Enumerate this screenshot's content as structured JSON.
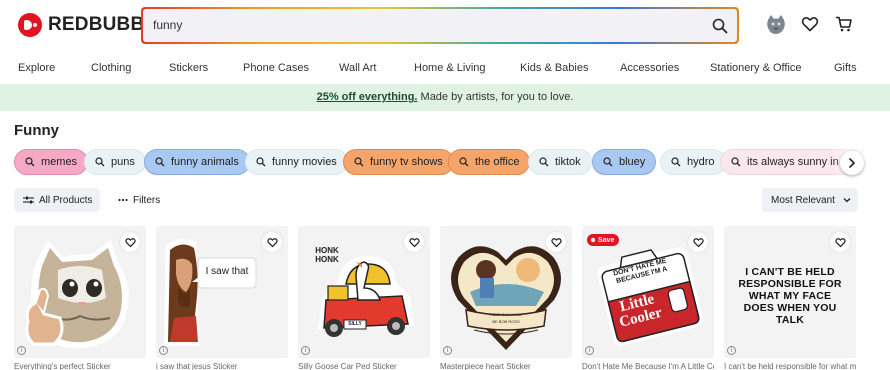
{
  "brand": {
    "name": "REDBUBBLE",
    "accent": "#e41321"
  },
  "search": {
    "value": "funny",
    "icon": "search-icon"
  },
  "header_icons": [
    "avatar",
    "heart-icon",
    "cart-icon"
  ],
  "nav": [
    "Explore",
    "Clothing",
    "Stickers",
    "Phone Cases",
    "Wall Art",
    "Home & Living",
    "Kids & Babies",
    "Accessories",
    "Stationery & Office",
    "Gifts"
  ],
  "banner": {
    "link": "25% off everything.",
    "text": " Made by artists, for you to love."
  },
  "page_title": "Funny",
  "chips": [
    {
      "label": "memes",
      "style": "pink"
    },
    {
      "label": "puns",
      "style": "plain"
    },
    {
      "label": "funny animals",
      "style": "blue"
    },
    {
      "label": "funny movies",
      "style": "plain"
    },
    {
      "label": "funny tv shows",
      "style": "orange"
    },
    {
      "label": "the office",
      "style": "orange"
    },
    {
      "label": "tiktok",
      "style": "plain"
    },
    {
      "label": "bluey",
      "style": "blue"
    },
    {
      "label": "hydro",
      "style": "plain"
    },
    {
      "label": "its always sunny in philadelphia",
      "style": "light"
    }
  ],
  "controls": {
    "all_products": "All Products",
    "filters": "Filters",
    "sort": "Most Relevant"
  },
  "products": [
    {
      "caption": "Everything's perfect Sticker",
      "art": "crying-cat-thumbs-up"
    },
    {
      "caption": "i saw that jesus Sticker",
      "art": "jesus-i-saw-that",
      "art_text": "I saw that"
    },
    {
      "caption": "Silly Goose Car Ped Sticker",
      "art": "honk-goose-car",
      "art_text": "HONK HONK",
      "plate": "SILLY"
    },
    {
      "caption": "Masterpiece heart Sticker",
      "art": "heart-bob-ross",
      "banner1": "KEEP CALM AND",
      "banner2": "BE BOB ROSS"
    },
    {
      "caption": "Don't Hate Me Because I'm A Little Cooler",
      "art": "little-cooler",
      "save": "Save",
      "art_text_top": "DON'T HATE ME BECAUSE I'M A",
      "art_text_main": "Little Cooler"
    },
    {
      "caption": "I can't be held responsible for what my face does",
      "art": "text-sticker",
      "art_text": "I CAN'T BE HELD RESPONSIBLE FOR WHAT MY FACE DOES WHEN YOU TALK"
    }
  ]
}
